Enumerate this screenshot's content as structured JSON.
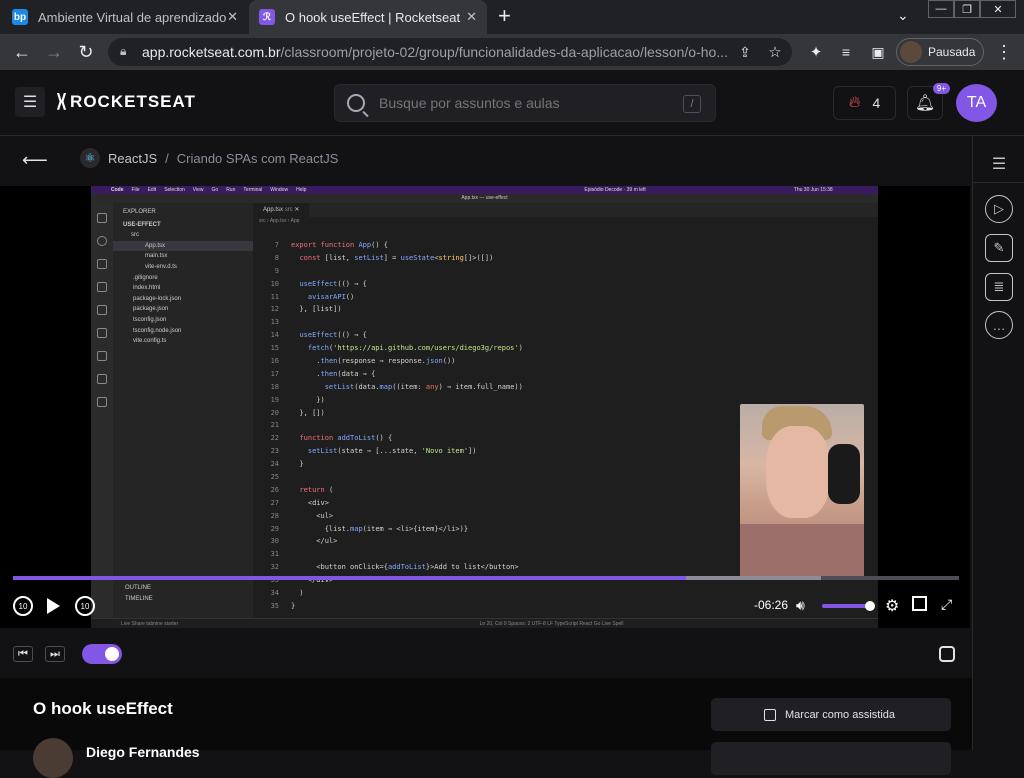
{
  "browser": {
    "tabs": [
      {
        "title": "Ambiente Virtual de aprendizado",
        "favicon": "bp"
      },
      {
        "title": "O hook useEffect | Rocketseat",
        "favicon": "rs"
      }
    ],
    "url_host": "app.rocketseat.com.br",
    "url_path": "/classroom/projeto-02/group/funcionalidades-da-aplicacao/lesson/o-ho...",
    "profile_label": "Pausada"
  },
  "header": {
    "logo": "ROCKETSEAT",
    "search_placeholder": "Busque por assuntos e aulas",
    "search_shortcut": "/",
    "streak_count": "4",
    "notifications_badge": "9+",
    "avatar_initials": "TA"
  },
  "breadcrumb": {
    "course": "ReactJS",
    "separator": "/",
    "module": "Criando SPAs com ReactJS"
  },
  "vscode": {
    "menubar": [
      "Code",
      "File",
      "Edit",
      "Selection",
      "View",
      "Go",
      "Run",
      "Terminal",
      "Window",
      "Help"
    ],
    "menubar_right": "Episódio Decode · 39 m left",
    "clock": "Thu 30 Jun 15:38",
    "window_title": "App.tsx — use-effect",
    "explorer_title": "EXPLORER",
    "project": "USE-EFFECT",
    "files": [
      {
        "name": "src",
        "indent": 1
      },
      {
        "name": "App.tsx",
        "indent": 2
      },
      {
        "name": "main.tsx",
        "indent": 2
      },
      {
        "name": "vite-env.d.ts",
        "indent": 2
      },
      {
        "name": ".gitignore",
        "indent": 1
      },
      {
        "name": "index.html",
        "indent": 1
      },
      {
        "name": "package-lock.json",
        "indent": 1
      },
      {
        "name": "package.json",
        "indent": 1
      },
      {
        "name": "tsconfig.json",
        "indent": 1
      },
      {
        "name": "tsconfig.node.json",
        "indent": 1
      },
      {
        "name": "vite.config.ts",
        "indent": 1
      }
    ],
    "outline": "OUTLINE",
    "timeline": "TIMELINE",
    "active_tab": "App.tsx",
    "tab_suffix": "src",
    "editor_breadcrumb": "src › App.tsx › App",
    "code_lines": [
      {
        "n": "7",
        "t": "export function App() {"
      },
      {
        "n": "8",
        "t": "  const [list, setList] = useState<string[]>([])"
      },
      {
        "n": "9",
        "t": ""
      },
      {
        "n": "10",
        "t": "  useEffect(() ⇒ {"
      },
      {
        "n": "11",
        "t": "    avisarAPI()"
      },
      {
        "n": "12",
        "t": "  }, [list])"
      },
      {
        "n": "13",
        "t": ""
      },
      {
        "n": "14",
        "t": "  useEffect(() ⇒ {"
      },
      {
        "n": "15",
        "t": "    fetch('https://api.github.com/users/diego3g/repos')"
      },
      {
        "n": "16",
        "t": "      .then(response ⇒ response.json())"
      },
      {
        "n": "17",
        "t": "      .then(data ⇒ {"
      },
      {
        "n": "18",
        "t": "        setList(data.map((item: any) ⇒ item.full_name))"
      },
      {
        "n": "19",
        "t": "      })"
      },
      {
        "n": "20",
        "t": "  }, [])"
      },
      {
        "n": "21",
        "t": ""
      },
      {
        "n": "22",
        "t": "  function addToList() {"
      },
      {
        "n": "23",
        "t": "    setList(state ⇒ [...state, 'Novo item'])"
      },
      {
        "n": "24",
        "t": "  }"
      },
      {
        "n": "25",
        "t": ""
      },
      {
        "n": "26",
        "t": "  return ("
      },
      {
        "n": "27",
        "t": "    <div>"
      },
      {
        "n": "28",
        "t": "      <ul>"
      },
      {
        "n": "29",
        "t": "        {list.map(item ⇒ <li>{item}</li>)}"
      },
      {
        "n": "30",
        "t": "      </ul>"
      },
      {
        "n": "31",
        "t": ""
      },
      {
        "n": "32",
        "t": "      <button onClick={addToList}>Add to list</button>"
      },
      {
        "n": "33",
        "t": "    </div>"
      },
      {
        "n": "34",
        "t": "  )"
      },
      {
        "n": "35",
        "t": "}"
      }
    ],
    "status_left": "Live Share   tabnine starter",
    "status_right": "Ln 20, Col 9   Spaces: 2   UTF-8   LF   TypeScript React   Go Live   Spell"
  },
  "player": {
    "time_remaining": "-06:26",
    "progress_fraction": 0.711,
    "buffered_fraction": 0.854,
    "volume_fraction": 0.9,
    "autoplay_on": true
  },
  "lesson": {
    "title": "O hook useEffect",
    "author": "Diego Fernandes",
    "mark_watched_label": "Marcar como assistida"
  },
  "colors": {
    "accent": "#8257e5",
    "background": "#121214"
  }
}
